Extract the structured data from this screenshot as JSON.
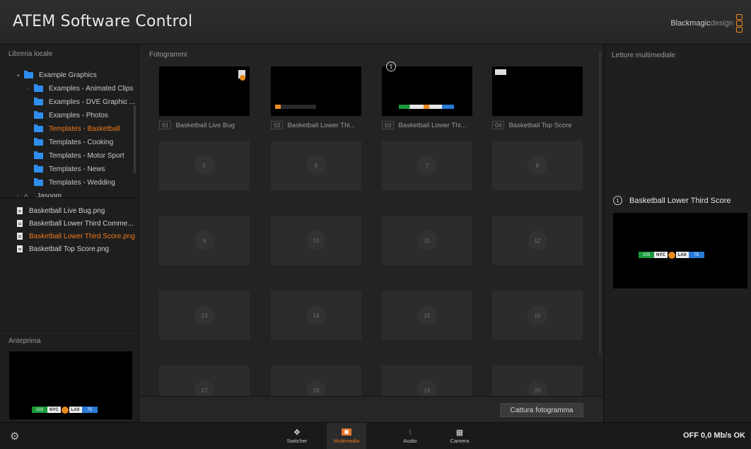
{
  "app": {
    "title": "ATEM Software Control",
    "brand_main": "Blackmagic",
    "brand_light": "design",
    "accent": "#f07a1a"
  },
  "left_panel": {
    "label": "Libreria locale",
    "tree": [
      {
        "label": "Example Graphics",
        "icon": "folder-icon"
      },
      {
        "label": "Examples - Animated Clips",
        "icon": "folder-icon"
      },
      {
        "label": "Examples - DVE Graphic ...",
        "icon": "folder-icon"
      },
      {
        "label": "Examples - Photos",
        "icon": "folder-icon"
      },
      {
        "label": "Templates - Basketball",
        "icon": "folder-icon",
        "selected": true
      },
      {
        "label": "Templates - Cooking",
        "icon": "folder-icon"
      },
      {
        "label": "Templates - Motor Sport",
        "icon": "folder-icon"
      },
      {
        "label": "Templates - News",
        "icon": "folder-icon"
      },
      {
        "label": "Templates - Wedding",
        "icon": "folder-icon"
      },
      {
        "label": "Jasonm",
        "icon": "home-icon"
      }
    ],
    "files": [
      {
        "label": "Basketball Live Bug.png"
      },
      {
        "label": "Basketball Lower Third Comme..."
      },
      {
        "label": "Basketball Lower Third Score.png",
        "selected": true
      },
      {
        "label": "Basketball Top Score.png"
      }
    ],
    "preview_label": "Anteprima"
  },
  "center_panel": {
    "label": "Fotogrammi",
    "slots": [
      {
        "num": "01",
        "label": "Basketball Live Bug",
        "filled": true
      },
      {
        "num": "02",
        "label": "Basketball Lower Thi...",
        "filled": true
      },
      {
        "num": "03",
        "label": "Basketball Lower Thi...",
        "filled": true,
        "marker": "1"
      },
      {
        "num": "04",
        "label": "Basketball Top Score",
        "filled": true
      },
      {
        "num": "5"
      },
      {
        "num": "6"
      },
      {
        "num": "7"
      },
      {
        "num": "8"
      },
      {
        "num": "9"
      },
      {
        "num": "10"
      },
      {
        "num": "11"
      },
      {
        "num": "12"
      },
      {
        "num": "13"
      },
      {
        "num": "14"
      },
      {
        "num": "15"
      },
      {
        "num": "16"
      },
      {
        "num": "17"
      },
      {
        "num": "18"
      },
      {
        "num": "19"
      },
      {
        "num": "20"
      }
    ],
    "capture_button": "Cattura fotogramma"
  },
  "right_panel": {
    "label": "Lettore multimediale",
    "player_marker": "1",
    "player_title": "Basketball Lower Third Score"
  },
  "scoreboard": {
    "home": "103",
    "team1": "NYC",
    "team2": "LAX",
    "away": "75"
  },
  "status_bar": {
    "nav": [
      {
        "label": "Switcher",
        "icon": "switcher-icon"
      },
      {
        "label": "Multimedia",
        "icon": "media-icon",
        "active": true
      },
      {
        "label": "Audio",
        "icon": "audio-icon"
      },
      {
        "label": "Camera",
        "icon": "camera-icon"
      }
    ],
    "status": "OFF 0,0 Mb/s OK"
  }
}
